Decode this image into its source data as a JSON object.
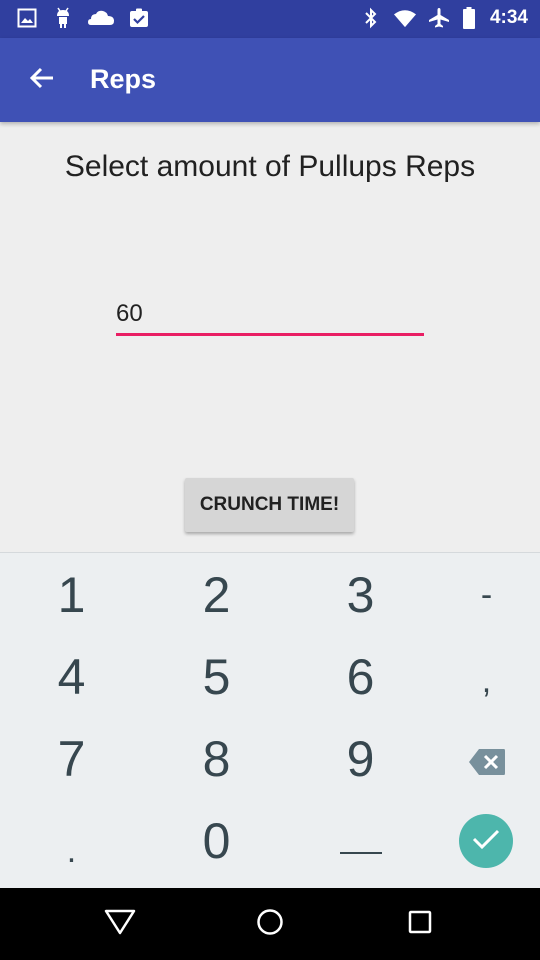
{
  "status_bar": {
    "time": "4:34",
    "left_icons": [
      "image-icon",
      "android-icon",
      "cloud-icon",
      "clipboard-check-icon"
    ],
    "right_icons": [
      "bluetooth-icon",
      "wifi-icon",
      "airplane-icon",
      "battery-icon"
    ]
  },
  "app_bar": {
    "title": "Reps",
    "back_icon": "arrow-back-icon",
    "color": "#3f51b5"
  },
  "content": {
    "prompt": "Select amount of Pullups Reps",
    "reps_value": "60",
    "accent_color": "#e91e63",
    "button_label": "CRUNCH TIME!"
  },
  "keypad": {
    "rows": [
      [
        "1",
        "2",
        "3",
        "-"
      ],
      [
        "4",
        "5",
        "6",
        ","
      ],
      [
        "7",
        "8",
        "9",
        "backspace-icon"
      ],
      [
        ".",
        "0",
        "space-icon",
        "done-icon"
      ]
    ],
    "keys": {
      "k1": "1",
      "k2": "2",
      "k3": "3",
      "dash": "-",
      "k4": "4",
      "k5": "5",
      "k6": "6",
      "comma": ",",
      "k7": "7",
      "k8": "8",
      "k9": "9",
      "period": ".",
      "k0": "0"
    },
    "done_color": "#4db6ac"
  },
  "nav_bar": {
    "icons": [
      "back-triangle-icon",
      "home-circle-icon",
      "recents-square-icon"
    ]
  }
}
